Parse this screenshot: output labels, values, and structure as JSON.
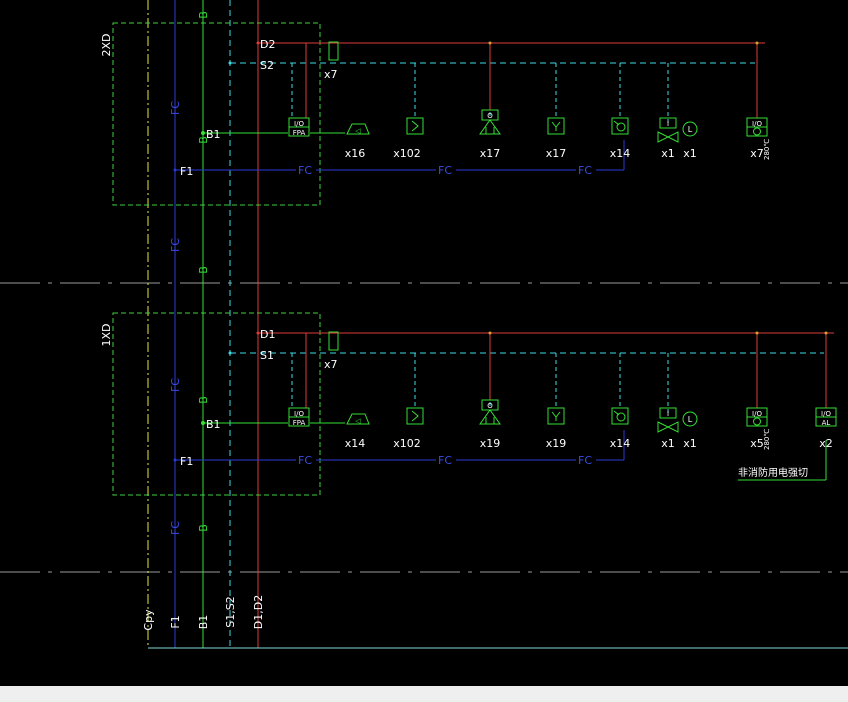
{
  "colors": {
    "background": "#000000",
    "bus_d": "#e03a3a",
    "bus_s": "#3fd7e6",
    "bus_b": "#35e035",
    "bus_f": "#2a3ad8",
    "fc_label": "#3a4ae6",
    "cpy_line": "#e6e63a",
    "floor_box": "#3ecf3e",
    "device": "#35e035",
    "text": "#ffffff",
    "floor_divider": "#9a9a9a",
    "bottom_line": "#7fd9d9"
  },
  "bus_labels": {
    "cpy": "Cpy",
    "f1": "F1",
    "b1": "B1",
    "s": "S1,S2",
    "d": "D1,D2"
  },
  "mid_labels": {
    "fc": "FC",
    "b": "B"
  },
  "floors": [
    {
      "name": "2XD",
      "d_label": "D2",
      "s_label": "S2",
      "b_label": "B1",
      "f_label": "F1",
      "relay_count": "x7",
      "fc_labels": [
        "FC",
        "FC",
        "FC"
      ],
      "devices": [
        {
          "icon": "io-module-fpa",
          "top": "I/O",
          "bottom": "FPA",
          "count": ""
        },
        {
          "icon": "sounder-icon",
          "count": "x16"
        },
        {
          "icon": "smoke-detector-icon",
          "count": "x102"
        },
        {
          "icon": "manual-call-point-icon",
          "top": "O",
          "count": "x17"
        },
        {
          "icon": "heat-detector-icon",
          "count": "x17"
        },
        {
          "icon": "hydrant-button-icon",
          "count": "x14"
        },
        {
          "icon": "valve-icon",
          "top": "I",
          "count": "x1"
        },
        {
          "icon": "level-switch-icon",
          "label": "L",
          "count": "x1"
        },
        {
          "icon": "damper-io-icon",
          "top": "I/O",
          "count": "x7",
          "sub": "280℃"
        }
      ]
    },
    {
      "name": "1XD",
      "d_label": "D1",
      "s_label": "S1",
      "b_label": "B1",
      "f_label": "F1",
      "relay_count": "x7",
      "fc_labels": [
        "FC",
        "FC",
        "FC"
      ],
      "devices": [
        {
          "icon": "io-module-fpa",
          "top": "I/O",
          "bottom": "FPA",
          "count": ""
        },
        {
          "icon": "sounder-icon",
          "count": "x14"
        },
        {
          "icon": "smoke-detector-icon",
          "count": "x102"
        },
        {
          "icon": "manual-call-point-icon",
          "top": "O",
          "count": "x19"
        },
        {
          "icon": "heat-detector-icon",
          "count": "x19"
        },
        {
          "icon": "hydrant-button-icon",
          "count": "x14"
        },
        {
          "icon": "valve-icon",
          "top": "I",
          "count": "x1"
        },
        {
          "icon": "level-switch-icon",
          "label": "L",
          "count": "x1"
        },
        {
          "icon": "damper-io-icon",
          "top": "I/O",
          "count": "x5",
          "sub": "280℃"
        },
        {
          "icon": "alarm-io-icon",
          "top": "I/O",
          "bottom": "AL",
          "count": "x2"
        }
      ],
      "note": "非消防用电强切"
    }
  ]
}
